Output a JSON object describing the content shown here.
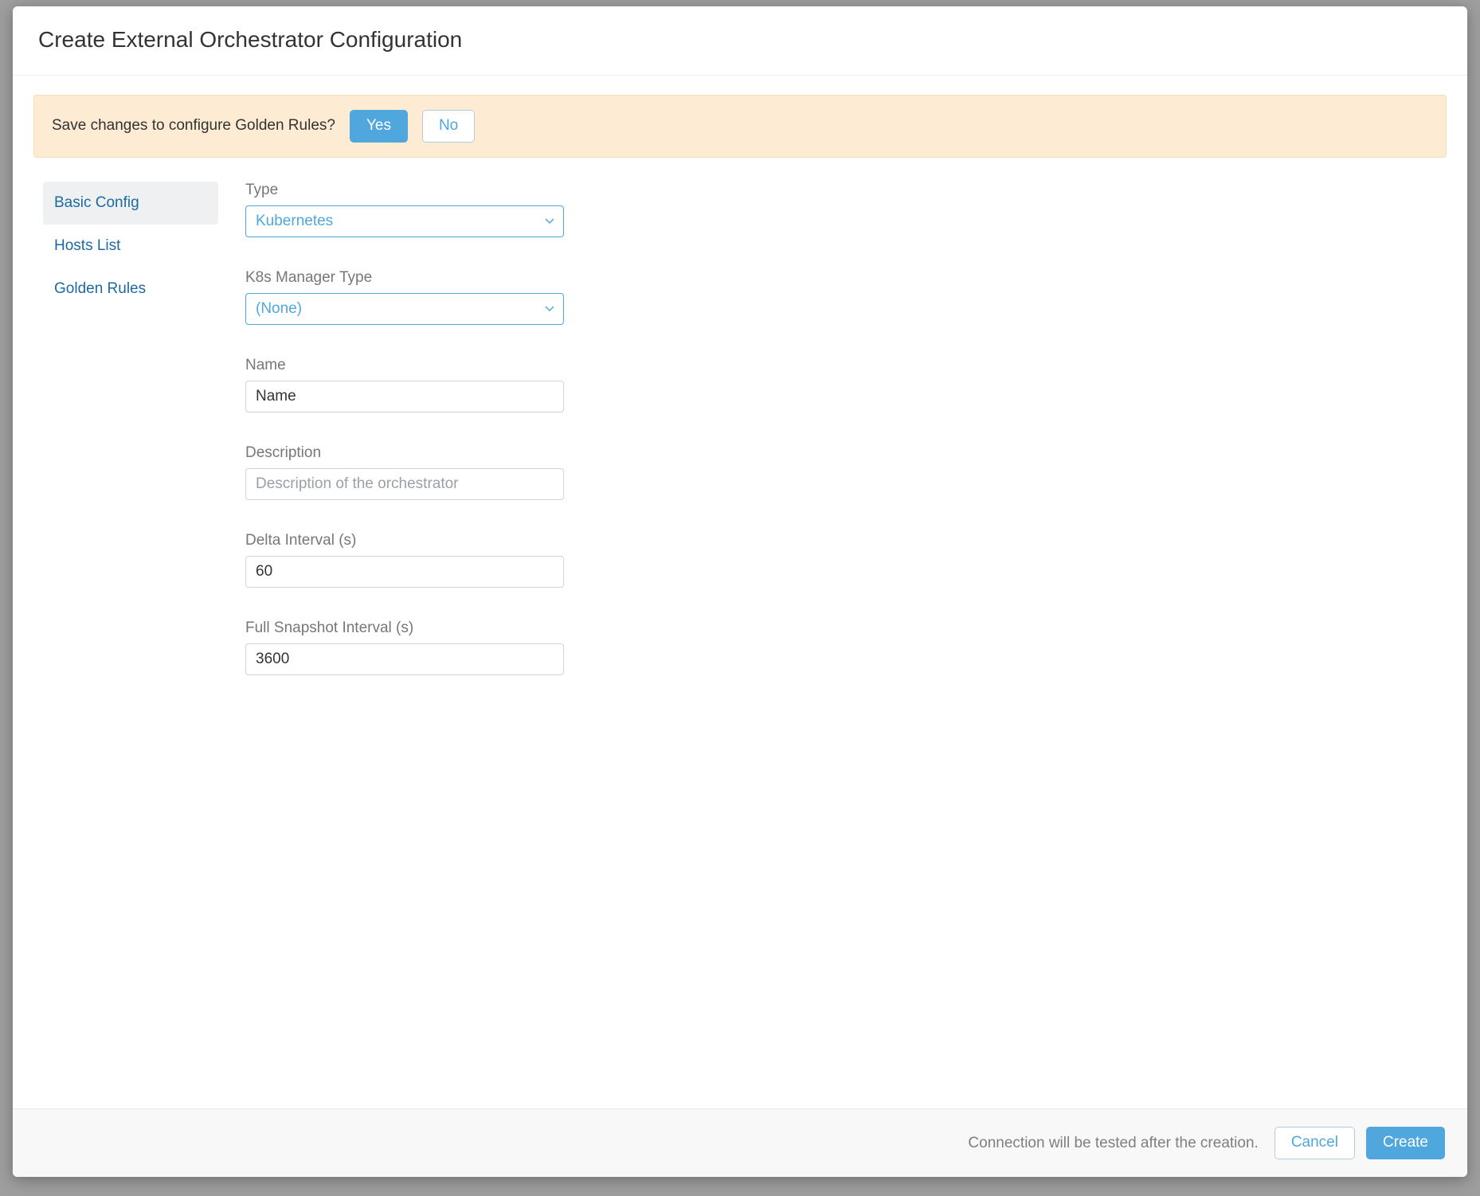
{
  "modal": {
    "title": "Create External Orchestrator Configuration"
  },
  "alert": {
    "text": "Save changes to configure Golden Rules?",
    "yes": "Yes",
    "no": "No"
  },
  "tabs": {
    "items": [
      {
        "label": "Basic Config",
        "active": true
      },
      {
        "label": "Hosts List",
        "active": false
      },
      {
        "label": "Golden Rules",
        "active": false
      }
    ]
  },
  "form": {
    "type": {
      "label": "Type",
      "value": "Kubernetes"
    },
    "k8s_manager_type": {
      "label": "K8s Manager Type",
      "value": "(None)"
    },
    "name": {
      "label": "Name",
      "value": "Name",
      "placeholder": "Name"
    },
    "description": {
      "label": "Description",
      "value": "",
      "placeholder": "Description of the orchestrator"
    },
    "delta_interval": {
      "label": "Delta Interval (s)",
      "value": "60"
    },
    "full_snapshot_interval": {
      "label": "Full Snapshot Interval (s)",
      "value": "3600"
    }
  },
  "footer": {
    "note": "Connection will be tested after the creation.",
    "cancel": "Cancel",
    "create": "Create"
  }
}
